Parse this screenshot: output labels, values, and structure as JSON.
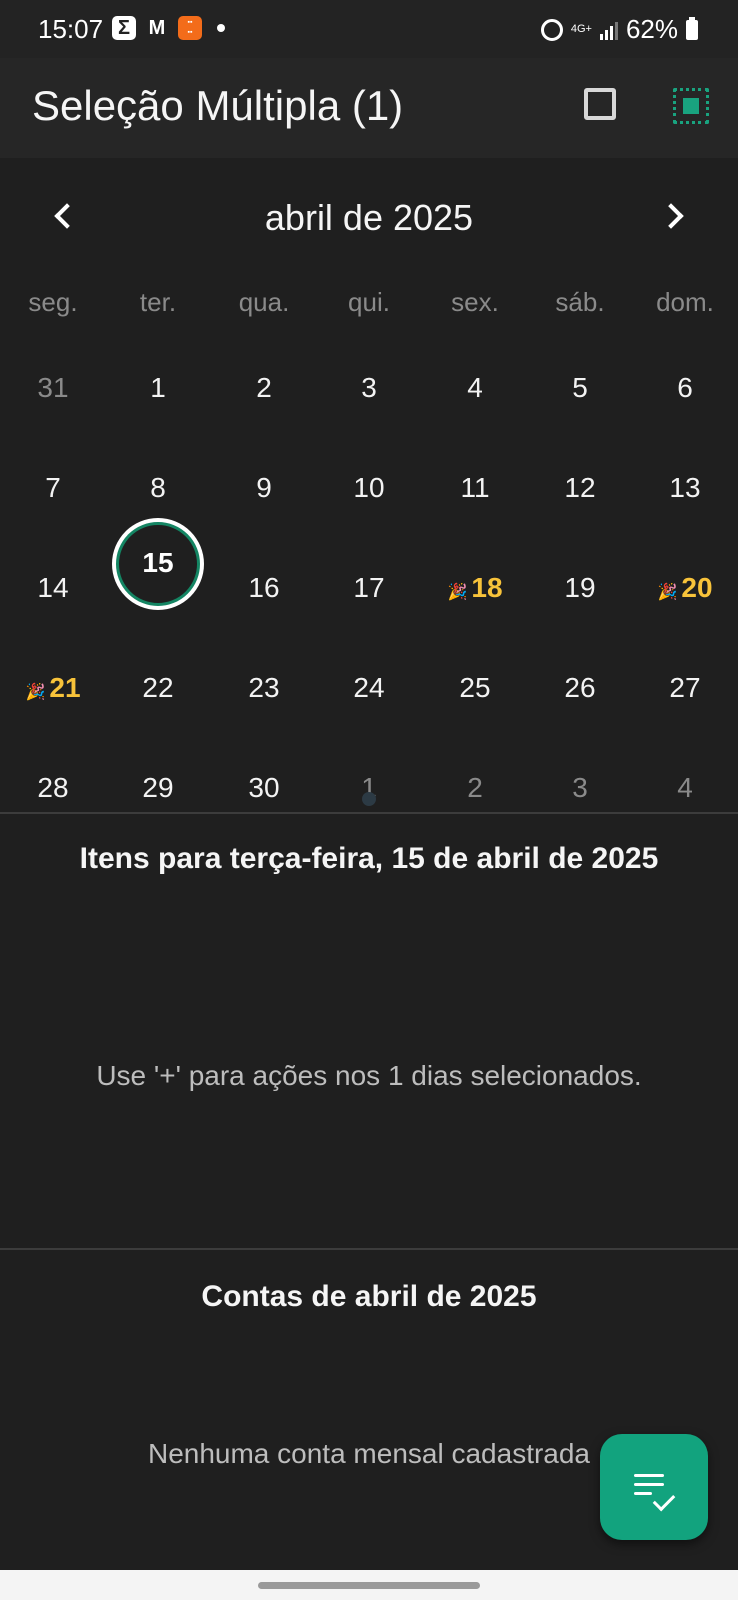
{
  "status_bar": {
    "time": "15:07",
    "apps": [
      "sigma-icon",
      "gmail-icon",
      "temu-icon"
    ],
    "network": "4G+",
    "battery": "62%"
  },
  "app_bar": {
    "title": "Seleção Múltipla (1)",
    "actions": [
      "square-icon",
      "select-all-icon"
    ],
    "accent_color": "#19a37f"
  },
  "calendar": {
    "month_title": "abril de 2025",
    "weekdays": [
      "seg.",
      "ter.",
      "qua.",
      "qui.",
      "sex.",
      "sáb.",
      "dom."
    ],
    "weeks": [
      [
        "31",
        "1",
        "2",
        "3",
        "4",
        "5",
        "6"
      ],
      [
        "7",
        "8",
        "9",
        "10",
        "11",
        "12",
        "13"
      ],
      [
        "14",
        "15",
        "16",
        "17",
        "18",
        "19",
        "20"
      ],
      [
        "21",
        "22",
        "23",
        "24",
        "25",
        "26",
        "27"
      ],
      [
        "28",
        "29",
        "30",
        "1",
        "2",
        "3",
        "4"
      ]
    ],
    "selected_day": "15",
    "holidays": [
      "18",
      "20",
      "21"
    ],
    "holiday_color": "#f8c33a"
  },
  "day_section": {
    "title": "Itens para terça-feira, 15 de abril de 2025",
    "message": "Use '+' para ações nos 1 dias selecionados."
  },
  "accounts_section": {
    "title": "Contas de abril de 2025",
    "message": "Nenhuma conta mensal cadastrada"
  },
  "fab": {
    "icon": "playlist-check-icon",
    "color": "#12a37e"
  }
}
